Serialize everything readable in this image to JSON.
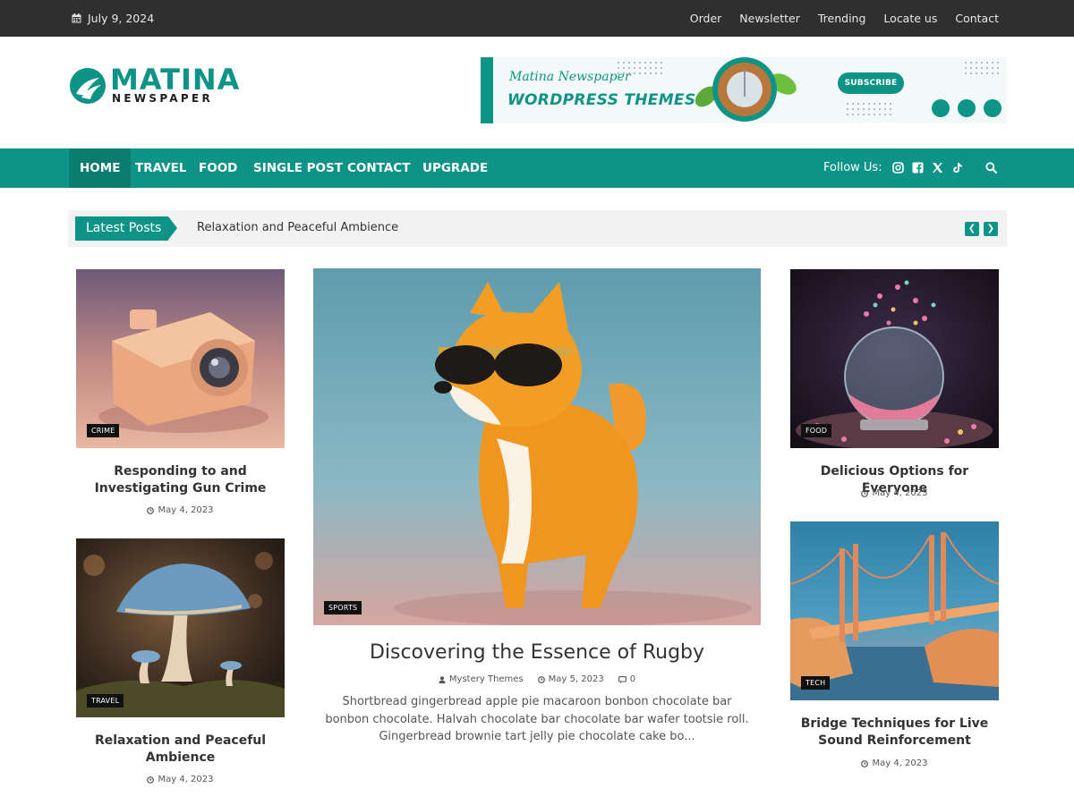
{
  "topbar": {
    "date": "July 9, 2024",
    "links": [
      "Order",
      "Newsletter",
      "Trending",
      "Locate us",
      "Contact"
    ]
  },
  "logo": {
    "title": "MATINA",
    "subtitle": "NEWSPAPER"
  },
  "banner": {
    "line1": "Matina Newspaper",
    "line2": "WORDPRESS THEMES!",
    "button": "SUBSCRIBE"
  },
  "nav": {
    "items": [
      "HOME",
      "TRAVEL",
      "FOOD",
      "SINGLE POST",
      "CONTACT",
      "UPGRADE"
    ],
    "follow_label": "Follow Us:",
    "social_icons": [
      "instagram-icon",
      "facebook-icon",
      "x-icon",
      "tiktok-icon"
    ]
  },
  "ticker": {
    "label": "Latest Posts",
    "headline": "Relaxation and Peaceful Ambience"
  },
  "posts": {
    "left_top": {
      "category": "CRIME",
      "title": "Responding to and Investigating Gun Crime",
      "date": "May 4, 2023"
    },
    "left_bottom": {
      "category": "TRAVEL",
      "title": "Relaxation and Peaceful Ambience",
      "date": "May 4, 2023"
    },
    "featured": {
      "category": "SPORTS",
      "title": "Discovering the Essence of Rugby",
      "author": "Mystery Themes",
      "date": "May 5, 2023",
      "comments": "0",
      "excerpt": "Shortbread gingerbread apple pie macaroon bonbon chocolate bar bonbon chocolate. Halvah chocolate bar chocolate bar wafer tootsie roll. Gingerbread brownie tart jelly pie chocolate cake bo..."
    },
    "right_top": {
      "category": "FOOD",
      "title": "Delicious Options for Everyone",
      "date": "May 4, 2023"
    },
    "right_bottom": {
      "category": "TECH",
      "title": "Bridge Techniques for Live Sound Reinforcement",
      "date": "May 4, 2023"
    }
  },
  "colors": {
    "accent": "#0e9486",
    "accent_dark": "#0b7c70",
    "topbar": "#2f2f2f"
  }
}
